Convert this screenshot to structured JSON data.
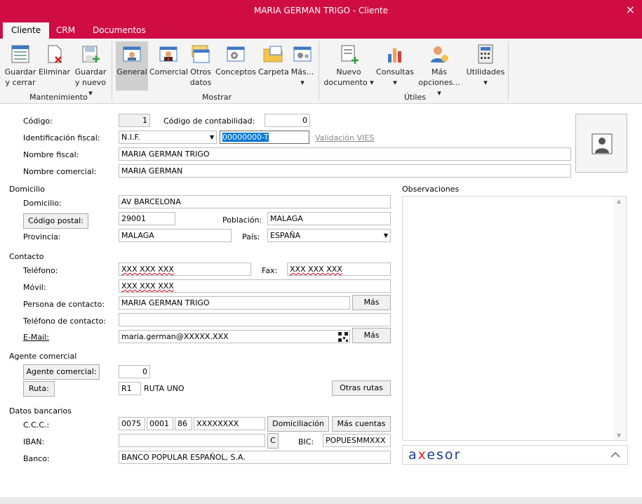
{
  "window": {
    "title": "MARIA GERMAN TRIGO - Cliente",
    "close_icon": "×"
  },
  "tabs": [
    "Cliente",
    "CRM",
    "Documentos"
  ],
  "ribbon": {
    "mantenimiento": {
      "label": "Mantenimiento",
      "save_close": [
        "Guardar",
        "y cerrar"
      ],
      "delete": "Eliminar",
      "save_new": [
        "Guardar",
        "y nuevo ▾"
      ]
    },
    "mostrar": {
      "label": "Mostrar",
      "general": "General",
      "comercial": "Comercial",
      "otros": [
        "Otros",
        "datos"
      ],
      "conceptos": "Conceptos",
      "carpeta": "Carpeta",
      "mas": [
        "Más...",
        "▾"
      ]
    },
    "utiles": {
      "label": "Útiles",
      "nuevo_doc": [
        "Nuevo",
        "documento ▾"
      ],
      "consultas": [
        "Consultas",
        "▾"
      ],
      "mas_opciones": [
        "Más",
        "opciones... ▾"
      ],
      "utilidades": [
        "Utilidades",
        "▾"
      ]
    }
  },
  "form": {
    "codigo_label": "Código:",
    "codigo": "1",
    "codigo_contab_label": "Código de contabilidad:",
    "codigo_contab": "0",
    "idfiscal_label": "Identificación fiscal:",
    "idfiscal_tipo": "N.I.F.",
    "idfiscal": "00000000-T",
    "validacion": "Validación VIES",
    "nombre_fiscal_label": "Nombre fiscal:",
    "nombre_fiscal": "MARIA GERMAN TRIGO",
    "nombre_comercial_label": "Nombre comercial:",
    "nombre_comercial": "MARIA GERMAN",
    "domicilio_section": "Domicilio",
    "domicilio_label": "Domicilio:",
    "domicilio": "AV BARCELONA",
    "cp_button": "Código postal:",
    "cp": "29001",
    "poblacion_label": "Población:",
    "poblacion": "MALAGA",
    "provincia_label": "Provincia:",
    "provincia": "MALAGA",
    "pais_label": "País:",
    "pais": "ESPAÑA",
    "contacto_section": "Contacto",
    "telefono_label": "Teléfono:",
    "telefono": "XXX XXX XXX",
    "fax_label": "Fax:",
    "fax": "XXX XXX XXX",
    "movil_label": "Móvil:",
    "movil": "XXX XXX XXX",
    "persona_label": "Persona de contacto:",
    "persona": "MARIA GERMAN TRIGO",
    "mas1": "Más",
    "tel_contacto_label": "Teléfono de contacto:",
    "tel_contacto": "",
    "email_label": "E-Mail:",
    "email": "maria.german@XXXXX.XXX",
    "mas2": "Más",
    "agente_section": "Agente comercial",
    "agente_button": "Agente comercial:",
    "agente": "0",
    "ruta_button": "Ruta:",
    "ruta_code": "R1",
    "ruta_name": "RUTA UNO",
    "otras_rutas": "Otras rutas",
    "bancos_section": "Datos bancarios",
    "ccc_label": "C.C.C.:",
    "ccc": [
      "0075",
      "0001",
      "86",
      "XXXXXXXX"
    ],
    "domiciliacion": "Domiciliación",
    "mas_cuentas": "Más cuentas",
    "iban_label": "IBAN:",
    "iban": "",
    "c_button": "C",
    "bic_label": "BIC:",
    "bic": "POPUESMMXXX",
    "banco_label": "Banco:",
    "banco": "BANCO POPULAR ESPAÑOL, S.A.",
    "observaciones_label": "Observaciones",
    "axesor": "axesor"
  },
  "colors": {
    "accent": "#cf0d42",
    "axesor_blue": "#1a3b8f",
    "axesor_red": "#e2231a"
  }
}
